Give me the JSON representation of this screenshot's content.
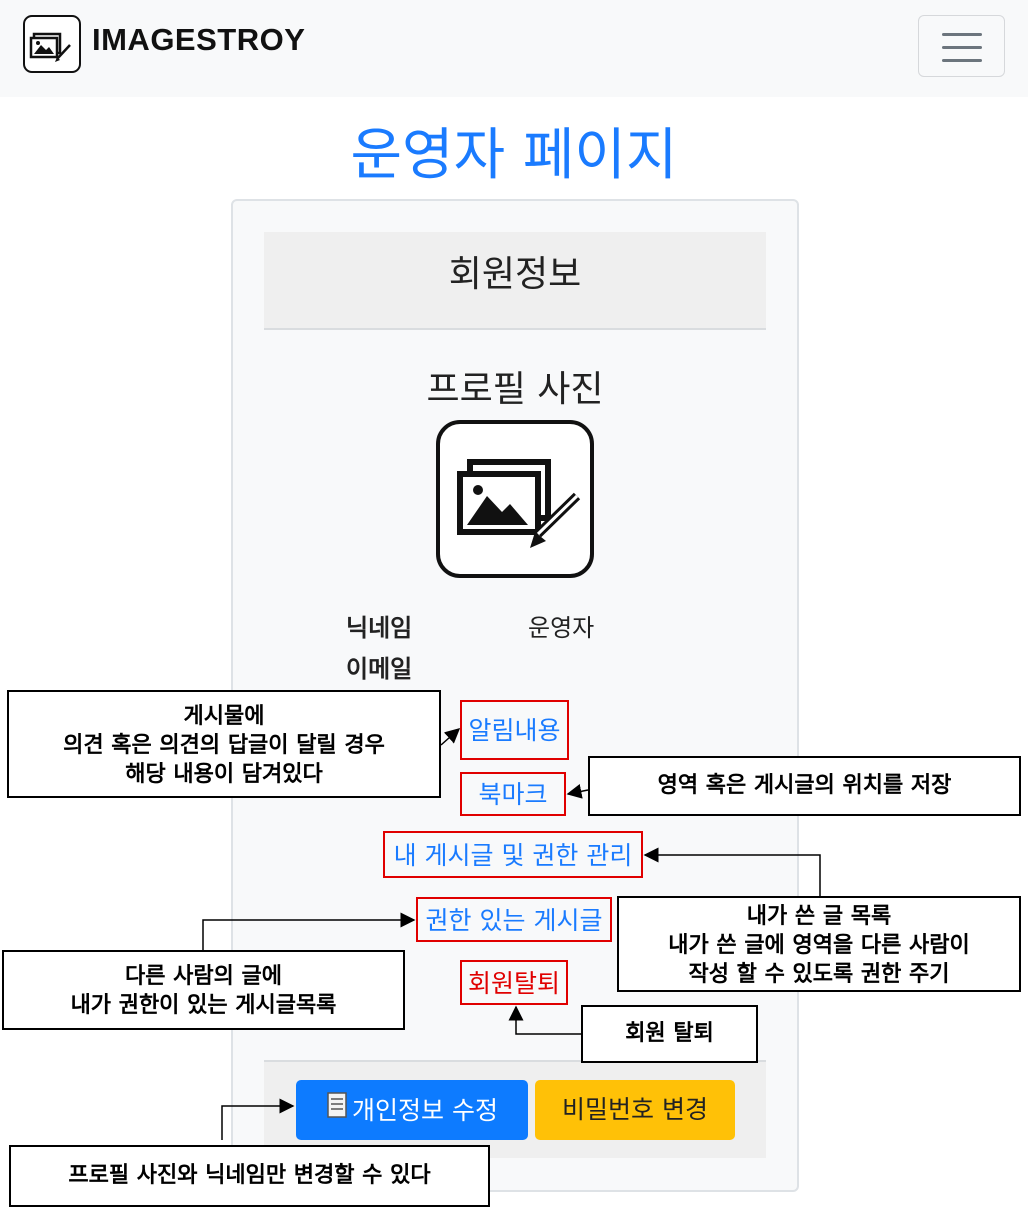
{
  "navbar": {
    "brand": "IMAGESTROY",
    "logo_icon": "image-edit-icon",
    "menu_icon": "hamburger-menu-icon"
  },
  "page": {
    "title": "운영자 페이지"
  },
  "card": {
    "header": "회원정보",
    "profile_label": "프로필 사진",
    "profile_icon": "image-edit-icon",
    "nickname_label": "닉네임",
    "nickname_value": "운영자",
    "email_label": "이메일",
    "email_value": ""
  },
  "links": {
    "notifications": "알림내용",
    "bookmark": "북마크",
    "my_posts": "내 게시글 및 권한 관리",
    "permitted_posts": "권한 있는 게시글",
    "withdraw": "회원탈퇴"
  },
  "buttons": {
    "edit_profile": "개인정보 수정",
    "edit_profile_icon": "document-icon",
    "change_password": "비밀번호 변경"
  },
  "annotations": {
    "notifications_note": [
      "게시물에",
      "의견 혹은 의견의 답글이 달릴 경우",
      "해당 내용이 담겨있다"
    ],
    "bookmark_note": "영역 혹은 게시글의 위치를 저장",
    "my_posts_note": [
      "내가 쓴 글 목록",
      "내가 쓴 글에 영역을 다른 사람이",
      "작성 할 수 있도록 권한 주기"
    ],
    "permitted_note": [
      "다른 사람의 글에",
      "내가 권한이 있는 게시글목록"
    ],
    "withdraw_note": "회원 탈퇴",
    "edit_note": "프로필 사진와 닉네임만 변경할 수 있다"
  },
  "colors": {
    "primary": "#0d7bff",
    "warning": "#ffc107",
    "danger": "#e00000",
    "title": "#1a7bff"
  }
}
